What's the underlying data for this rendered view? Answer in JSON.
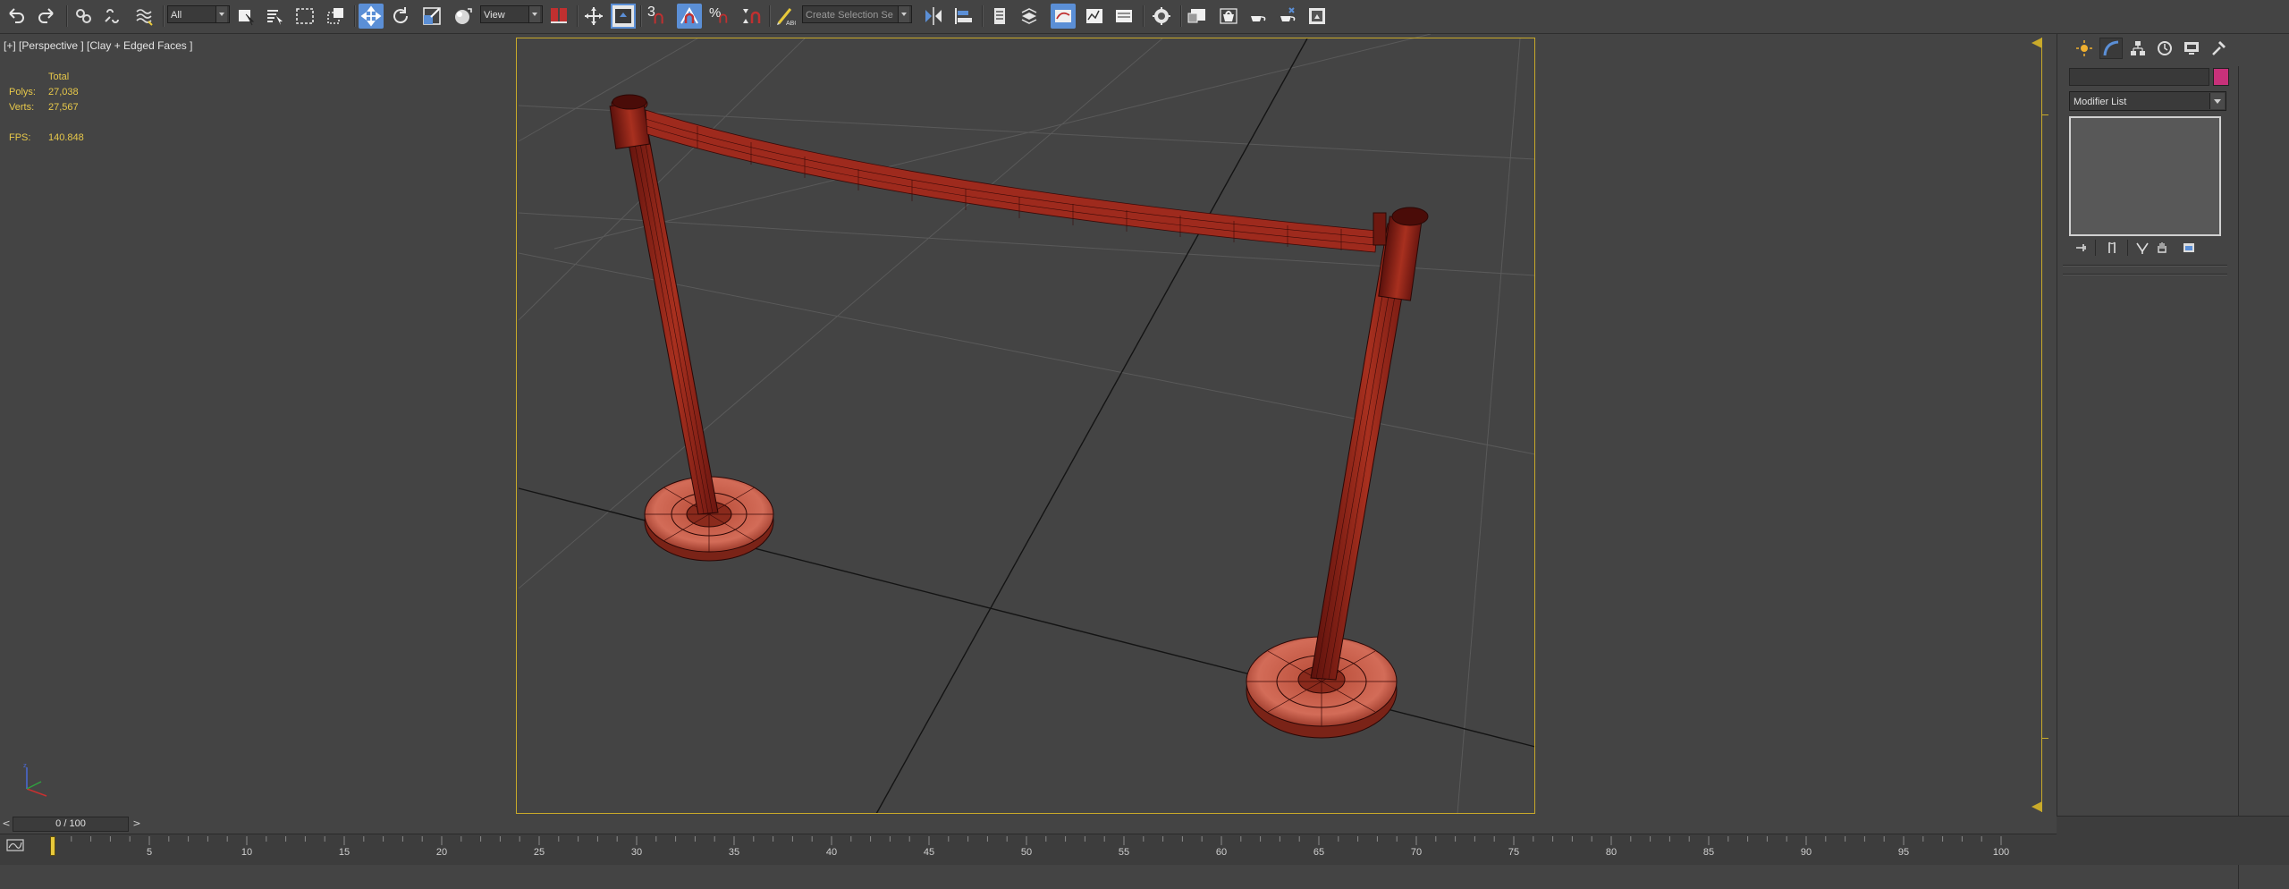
{
  "toolbar": {
    "selection_filter": "All",
    "reference_coord_system": "View",
    "snap_number": "3",
    "named_selection_sets": "Create Selection Se",
    "buttons": [
      {
        "name": "undo-icon"
      },
      {
        "name": "redo-icon"
      },
      {
        "name": "select-and-link-icon"
      },
      {
        "name": "unlink-selection-icon"
      },
      {
        "name": "bind-to-space-warp-icon"
      },
      {
        "name": "select-object-icon"
      },
      {
        "name": "select-by-name-icon"
      },
      {
        "name": "rectangular-selection-region-icon"
      },
      {
        "name": "window-crossing-icon"
      },
      {
        "name": "select-and-move-icon",
        "active": true
      },
      {
        "name": "select-and-rotate-icon"
      },
      {
        "name": "select-and-scale-icon"
      },
      {
        "name": "select-and-place-icon"
      },
      {
        "name": "select-manipulate-icon"
      },
      {
        "name": "keyboard-shortcut-override-icon"
      },
      {
        "name": "snaps-toggle-icon"
      },
      {
        "name": "angle-snap-toggle-icon",
        "active": true
      },
      {
        "name": "percent-snap-icon"
      },
      {
        "name": "spinner-snap-icon"
      },
      {
        "name": "edit-named-selection-icon"
      },
      {
        "name": "mirror-icon"
      },
      {
        "name": "align-icon"
      },
      {
        "name": "toggle-scene-explorer-icon"
      },
      {
        "name": "toggle-layer-explorer-icon"
      },
      {
        "name": "toggle-ribbon-icon"
      },
      {
        "name": "curve-editor-icon"
      },
      {
        "name": "schematic-view-icon"
      },
      {
        "name": "material-editor-icon"
      },
      {
        "name": "render-setup-icon"
      },
      {
        "name": "rendered-frame-window-icon"
      },
      {
        "name": "render-production-icon"
      },
      {
        "name": "render-iterative-icon"
      },
      {
        "name": "render-in-cloud-icon"
      }
    ]
  },
  "viewport": {
    "label": "[+] [Perspective ] [Clay + Edged Faces ]",
    "stats": {
      "total_label": "Total",
      "polys_label": "Polys:",
      "polys_value": "27,038",
      "verts_label": "Verts:",
      "verts_value": "27,567",
      "fps_label": "FPS:",
      "fps_value": "140.848"
    },
    "colors": {
      "background": "#444444",
      "safe_frame": "#c9aa2a",
      "stats_text": "#e7c84a",
      "object_fill": "#a52a22",
      "object_fill_light": "#d06a58",
      "wire": "#3a0a08"
    }
  },
  "command_panel": {
    "tabs": [
      {
        "name": "create-panel-tab",
        "icon": "sun-icon"
      },
      {
        "name": "modify-panel-tab",
        "icon": "modify-arc-icon",
        "active": true
      },
      {
        "name": "hierarchy-panel-tab",
        "icon": "hierarchy-icon"
      },
      {
        "name": "motion-panel-tab",
        "icon": "motion-icon"
      },
      {
        "name": "display-panel-tab",
        "icon": "display-monitor-icon"
      },
      {
        "name": "utilities-panel-tab",
        "icon": "hammer-icon"
      }
    ],
    "object_color": "#c8317a",
    "modifier_list_label": "Modifier List",
    "stack_buttons": [
      {
        "name": "pin-stack-icon"
      },
      {
        "name": "show-end-result-icon"
      },
      {
        "name": "make-unique-icon"
      },
      {
        "name": "remove-modifier-icon"
      },
      {
        "name": "configure-modifier-sets-icon"
      }
    ]
  },
  "timeline": {
    "prev_label": "<",
    "frame_display": "0 / 100",
    "next_label": ">",
    "ticks": [
      "5",
      "10",
      "15",
      "20",
      "25",
      "30",
      "35",
      "40",
      "45",
      "50",
      "55",
      "60",
      "65",
      "70",
      "75",
      "80",
      "85",
      "90",
      "95",
      "100"
    ]
  }
}
